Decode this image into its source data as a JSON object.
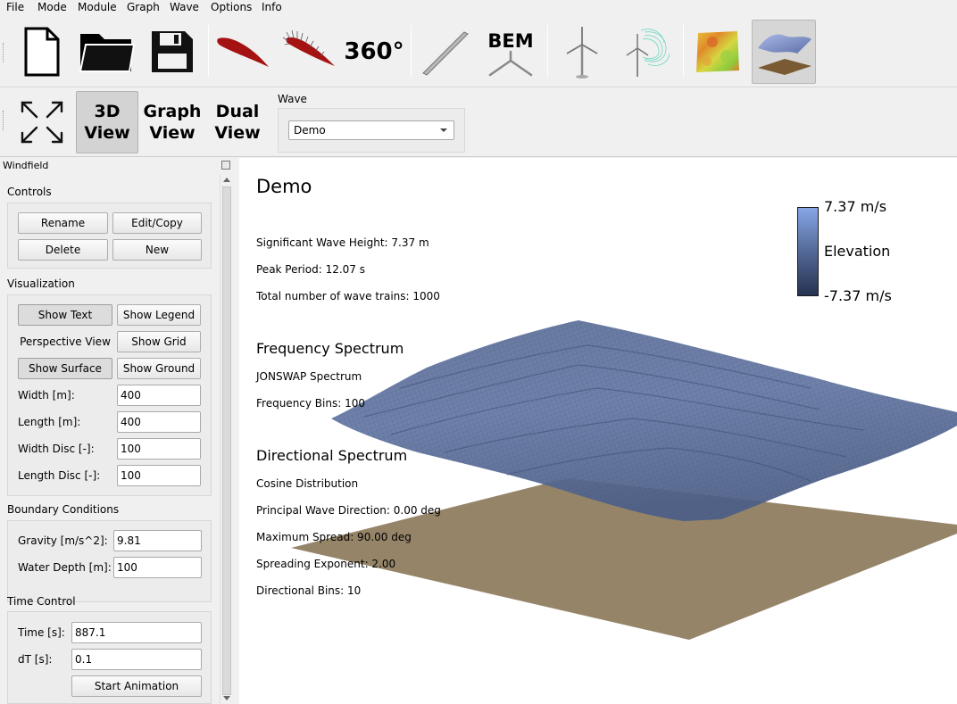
{
  "menu": [
    "File",
    "Mode",
    "Module",
    "Graph",
    "Wave",
    "Options",
    "Info"
  ],
  "toolbar": {
    "buttons": [
      "new-file",
      "open-folder",
      "save",
      "airfoil",
      "polar",
      "360-polar",
      "blade",
      "bem",
      "turbine-hawt",
      "turbine-vawt",
      "windfield",
      "wave"
    ],
    "label_360": "360°",
    "label_bem": "BEM"
  },
  "view_toolbar": {
    "btn_3d": "3D\nView",
    "btn_graph": "Graph\nView",
    "btn_dual": "Dual\nView",
    "wave_label": "Wave",
    "wave_selected": "Demo"
  },
  "dock": {
    "title": "Windfield",
    "controls_label": "Controls",
    "rename": "Rename",
    "edit_copy": "Edit/Copy",
    "delete": "Delete",
    "new": "New",
    "visualization_label": "Visualization",
    "show_text": "Show Text",
    "show_legend": "Show Legend",
    "perspective_view": "Perspective View",
    "show_grid": "Show Grid",
    "show_surface": "Show Surface",
    "show_ground": "Show Ground",
    "width_label": "Width [m]:",
    "width_value": "400",
    "length_label": "Length [m]:",
    "length_value": "400",
    "width_disc_label": "Width Disc [-]:",
    "width_disc_value": "100",
    "length_disc_label": "Length Disc [-]:",
    "length_disc_value": "100",
    "boundary_label": "Boundary Conditions",
    "gravity_label": "Gravity [m/s^2]:",
    "gravity_value": "9.81",
    "water_depth_label": "Water Depth [m]:",
    "water_depth_value": "100",
    "time_control_label": "Time Control",
    "time_label": "Time [s]:",
    "time_value": "887.1",
    "dt_label": "dT [s]:",
    "dt_value": "0.1",
    "start_animation": "Start Animation"
  },
  "viewport": {
    "title": "Demo",
    "sig_wave_height": "Significant Wave Height: 7.37 m",
    "peak_period": "Peak Period: 12.07 s",
    "num_wave_trains": "Total number of wave trains: 1000",
    "freq_heading": "Frequency Spectrum",
    "freq_type": "JONSWAP Spectrum",
    "freq_bins": "Frequency Bins: 100",
    "dir_heading": "Directional Spectrum",
    "dir_type": "Cosine Distribution",
    "principal_dir": "Principal Wave Direction: 0.00 deg",
    "max_spread": "Maximum Spread: 90.00 deg",
    "spread_exp": "Spreading Exponent: 2.00",
    "dir_bins": "Directional Bins: 10",
    "legend_max": "7.37 m/s",
    "legend_title": "Elevation",
    "legend_min": "-7.37 m/s"
  },
  "colors": {
    "ground": "#958468",
    "wave_surface": "#5a6f9a",
    "legend_top": "#86a6e6",
    "legend_bottom": "#253351"
  }
}
